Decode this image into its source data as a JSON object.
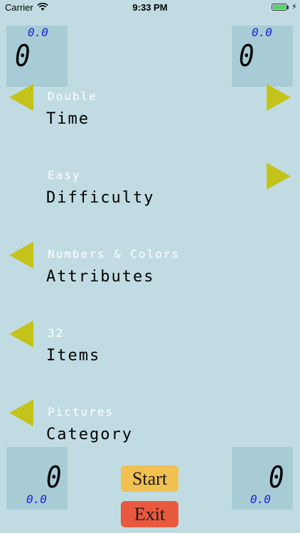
{
  "status_bar": {
    "carrier": "Carrier",
    "time": "9:33 PM"
  },
  "scores": {
    "top_left": {
      "main": "0",
      "sub": "0.0"
    },
    "top_right": {
      "main": "0",
      "sub": "0.0"
    },
    "bottom_left": {
      "main": "0",
      "sub": "0.0"
    },
    "bottom_right": {
      "main": "0",
      "sub": "0.0"
    }
  },
  "settings": {
    "time": {
      "value": "Double",
      "label": "Time"
    },
    "difficulty": {
      "value": "Easy",
      "label": "Difficulty"
    },
    "attributes": {
      "value": "Numbers & Colors",
      "label": "Attributes"
    },
    "items": {
      "value": "32",
      "label": "Items"
    },
    "category": {
      "value": "Pictures",
      "label": "Category"
    }
  },
  "buttons": {
    "start": "Start",
    "exit": "Exit"
  },
  "colors": {
    "background": "#c0dce2",
    "panel": "#a8ccd6",
    "arrow": "#c3c31a",
    "start": "#f0c050",
    "exit": "#e9593e",
    "digits_small": "#1c1cde"
  }
}
